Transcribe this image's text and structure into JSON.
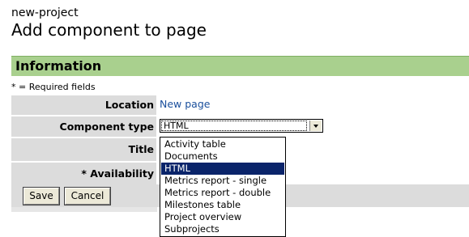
{
  "header": {
    "project_name": "new-project",
    "page_title": "Add component to page"
  },
  "section": {
    "title": "Information",
    "required_note": "* = Required fields",
    "bar_color": "#a9d08e"
  },
  "form": {
    "location": {
      "label": "Location",
      "value": "New page"
    },
    "component_type": {
      "label": "Component type",
      "selected": "HTML",
      "options": [
        "Activity table",
        "Documents",
        "HTML",
        "Metrics report - single",
        "Metrics report - double",
        "Milestones table",
        "Project overview",
        "Subprojects"
      ],
      "selected_index": 2
    },
    "title": {
      "label": "Title"
    },
    "availability": {
      "label": "* Availability"
    }
  },
  "actions": {
    "save_label": "Save",
    "cancel_label": "Cancel"
  }
}
